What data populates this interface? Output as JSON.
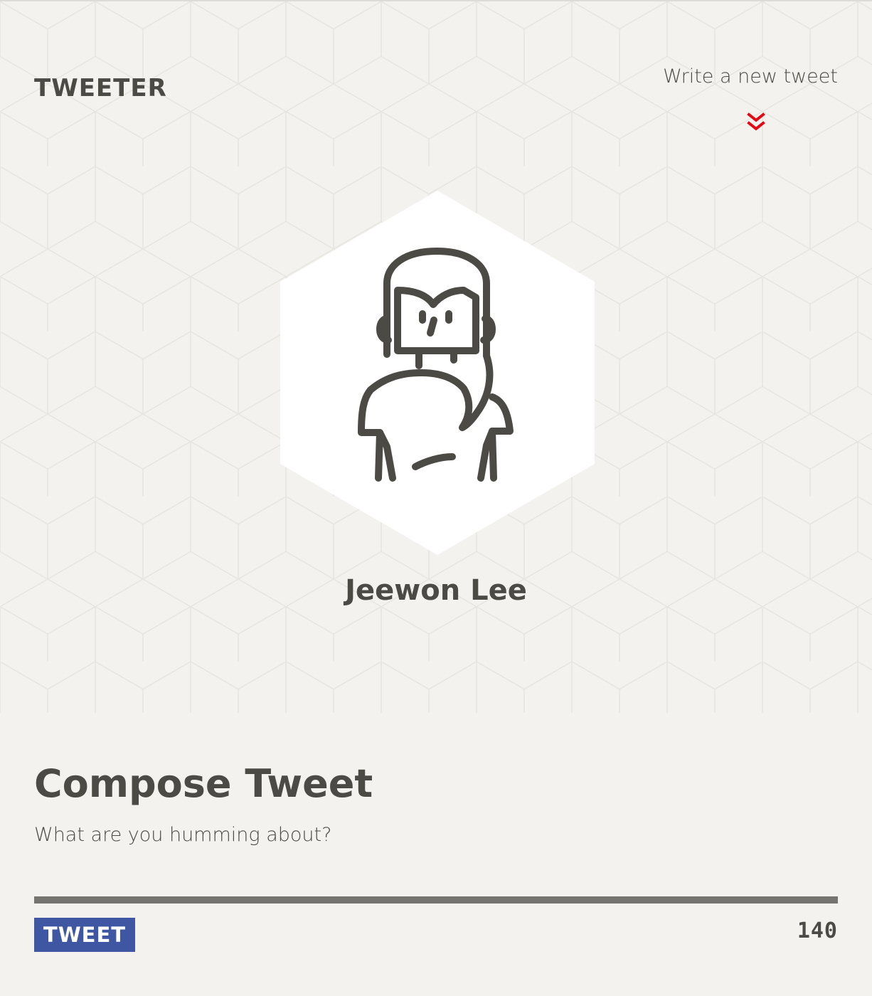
{
  "brand": "TWEETER",
  "header": {
    "write_link_label": "Write a new tweet",
    "chevron_color": "#e30613"
  },
  "profile": {
    "name": "Jeewon Lee",
    "avatar_icon": "woman-avatar-icon"
  },
  "compose": {
    "title": "Compose Tweet",
    "placeholder": "What are you humming about?",
    "value": "",
    "button_label": "TWEET",
    "counter": "140"
  },
  "colors": {
    "background": "#f3f2ee",
    "text": "#4b4a44",
    "button": "#3f57a3",
    "divider": "#75746f",
    "accent": "#e30613"
  }
}
